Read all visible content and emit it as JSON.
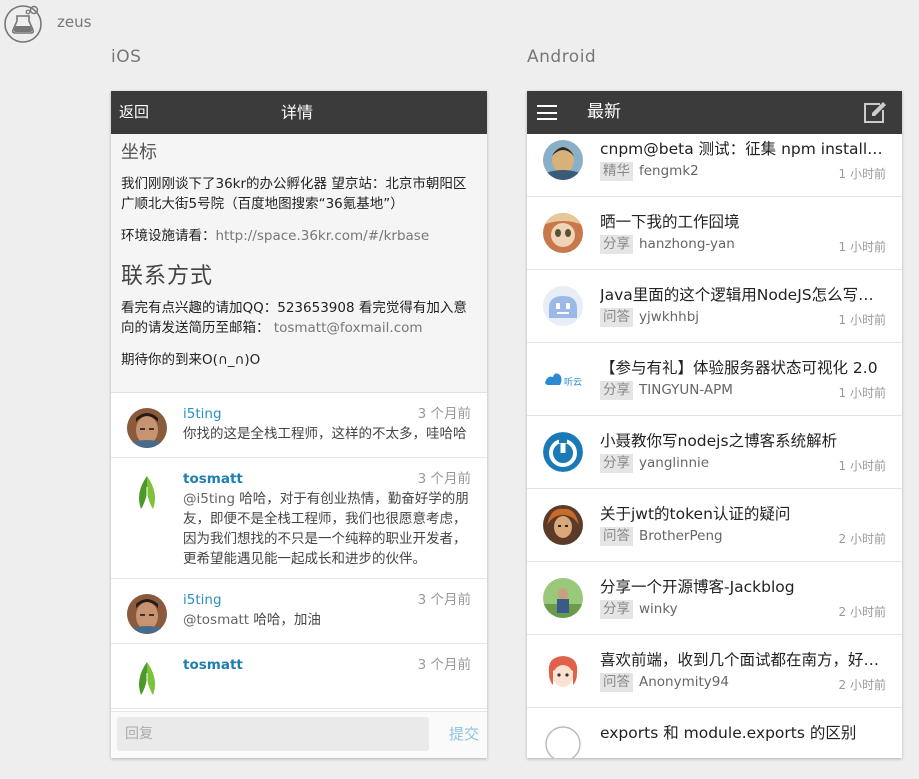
{
  "brand": {
    "name": "zeus"
  },
  "sections": {
    "ios_label": "iOS",
    "android_label": "Android"
  },
  "ios": {
    "back": "返回",
    "title": "详情",
    "content": {
      "heading1": "坐标",
      "p1": "我们刚刚谈下了36kr的办公孵化器 望京站：北京市朝阳区广顺北大街5号院（百度地图搜索“36氪基地”）",
      "p2_label": "环境设施请看：",
      "p2_link": "http://space.36kr.com/#/krbase",
      "heading2": "联系方式",
      "p3_text": "看完有点兴趣的请加QQ：523653908 看完觉得有加入意向的请发送简历至邮箱：",
      "p3_email": "tosmatt@foxmail.com",
      "p4": "期待你的到来O(∩_∩)O"
    },
    "comments": [
      {
        "user": "i5ting",
        "time": "3 个月前",
        "mention": "",
        "text": "你找的这是全栈工程师，这样的不太多，哇哈哈"
      },
      {
        "user": "tosmatt",
        "time": "3 个月前",
        "mention": "@i5ting",
        "text": " 哈哈，对于有创业热情，勤奋好学的朋友，即便不是全栈工程师，我们也很愿意考虑，因为我们想找的不只是一个纯粹的职业开发者，更希望能遇见能一起成长和进步的伙伴。"
      },
      {
        "user": "i5ting",
        "time": "3 个月前",
        "mention": "@tosmatt",
        "text": " 哈哈，加油"
      },
      {
        "user": "tosmatt",
        "time": "3 个月前",
        "mention": "",
        "text": ""
      }
    ],
    "reply": {
      "placeholder": "回复",
      "submit": "提交"
    }
  },
  "android": {
    "title": "最新",
    "topics": [
      {
        "title": "cnpm@beta 测试：征集 npm install 非常慢的模块",
        "tag": "精华",
        "author": "fengmk2",
        "time": "1 小时前"
      },
      {
        "title": "晒一下我的工作囧境",
        "tag": "分享",
        "author": "hanzhong-yan",
        "time": "1 小时前"
      },
      {
        "title": "Java里面的这个逻辑用NodeJS怎么写比较好",
        "tag": "问答",
        "author": "yjwkhhbj",
        "time": "1 小时前"
      },
      {
        "title": "【参与有礼】体验服务器状态可视化 2.0",
        "tag": "分享",
        "author": "TINGYUN-APM",
        "time": "1 小时前"
      },
      {
        "title": "小聂教你写nodejs之博客系统解析",
        "tag": "分享",
        "author": "yanglinnie",
        "time": "1 小时前"
      },
      {
        "title": "关于jwt的token认证的疑问",
        "tag": "问答",
        "author": "BrotherPeng",
        "time": "2 小时前"
      },
      {
        "title": "分享一个开源博客-Jackblog",
        "tag": "分享",
        "author": "winky",
        "time": "2 小时前"
      },
      {
        "title": "喜欢前端，收到几个面试都在南方，好纠结",
        "tag": "问答",
        "author": "Anonymity94",
        "time": "2 小时前"
      },
      {
        "title": "exports 和 module.exports 的区别",
        "tag": "",
        "author": "",
        "time": ""
      }
    ]
  }
}
